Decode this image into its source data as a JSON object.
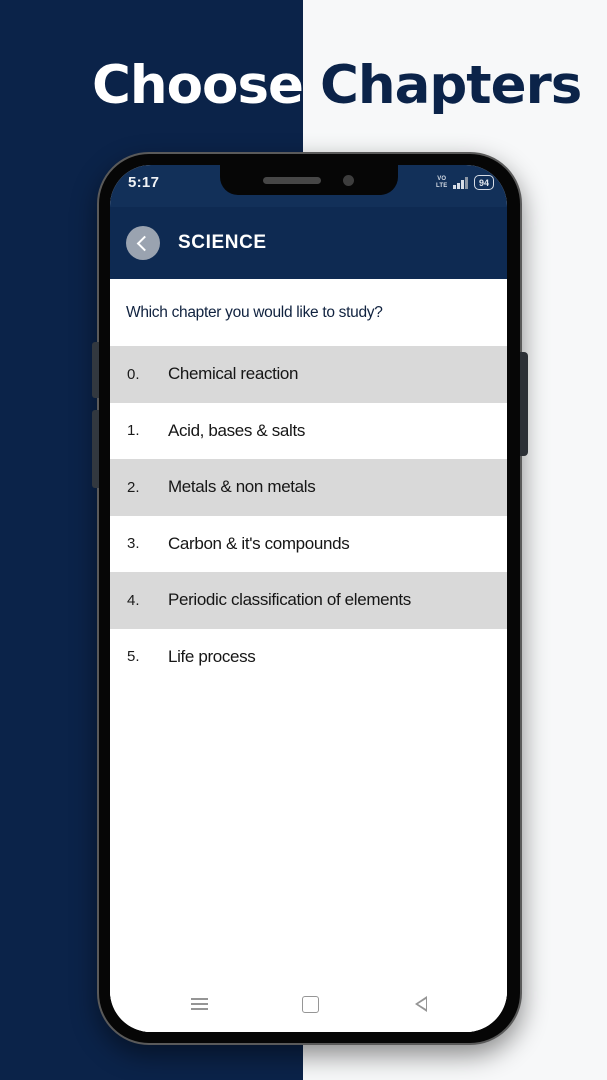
{
  "headline": {
    "word_one": "Choose",
    "word_two": "Chapters"
  },
  "colors": {
    "navy": "#0b2349",
    "offwhite": "#f7f8f9",
    "appbar": "#0e2a52",
    "row_alt": "#d9d9d9"
  },
  "phone": {
    "statusbar": {
      "time": "5:17",
      "volte_line1": "VO",
      "volte_line2": "LTE",
      "battery": "94",
      "signal_icon": "signal-bars-icon",
      "battery_icon": "battery-icon"
    },
    "appbar": {
      "back_icon": "chevron-left-icon",
      "title": "SCIENCE"
    },
    "content": {
      "prompt": "Which chapter you would like to study?",
      "chapters": [
        {
          "index": "0.",
          "title": "Chemical reaction"
        },
        {
          "index": "1.",
          "title": "Acid, bases & salts"
        },
        {
          "index": "2.",
          "title": "Metals & non metals"
        },
        {
          "index": "3.",
          "title": "Carbon & it's compounds"
        },
        {
          "index": "4.",
          "title": "Periodic classification of elements"
        },
        {
          "index": "5.",
          "title": "Life process"
        }
      ]
    },
    "navbar": {
      "recents_icon": "menu-icon",
      "home_icon": "square-home-icon",
      "back_icon": "triangle-back-icon"
    }
  }
}
